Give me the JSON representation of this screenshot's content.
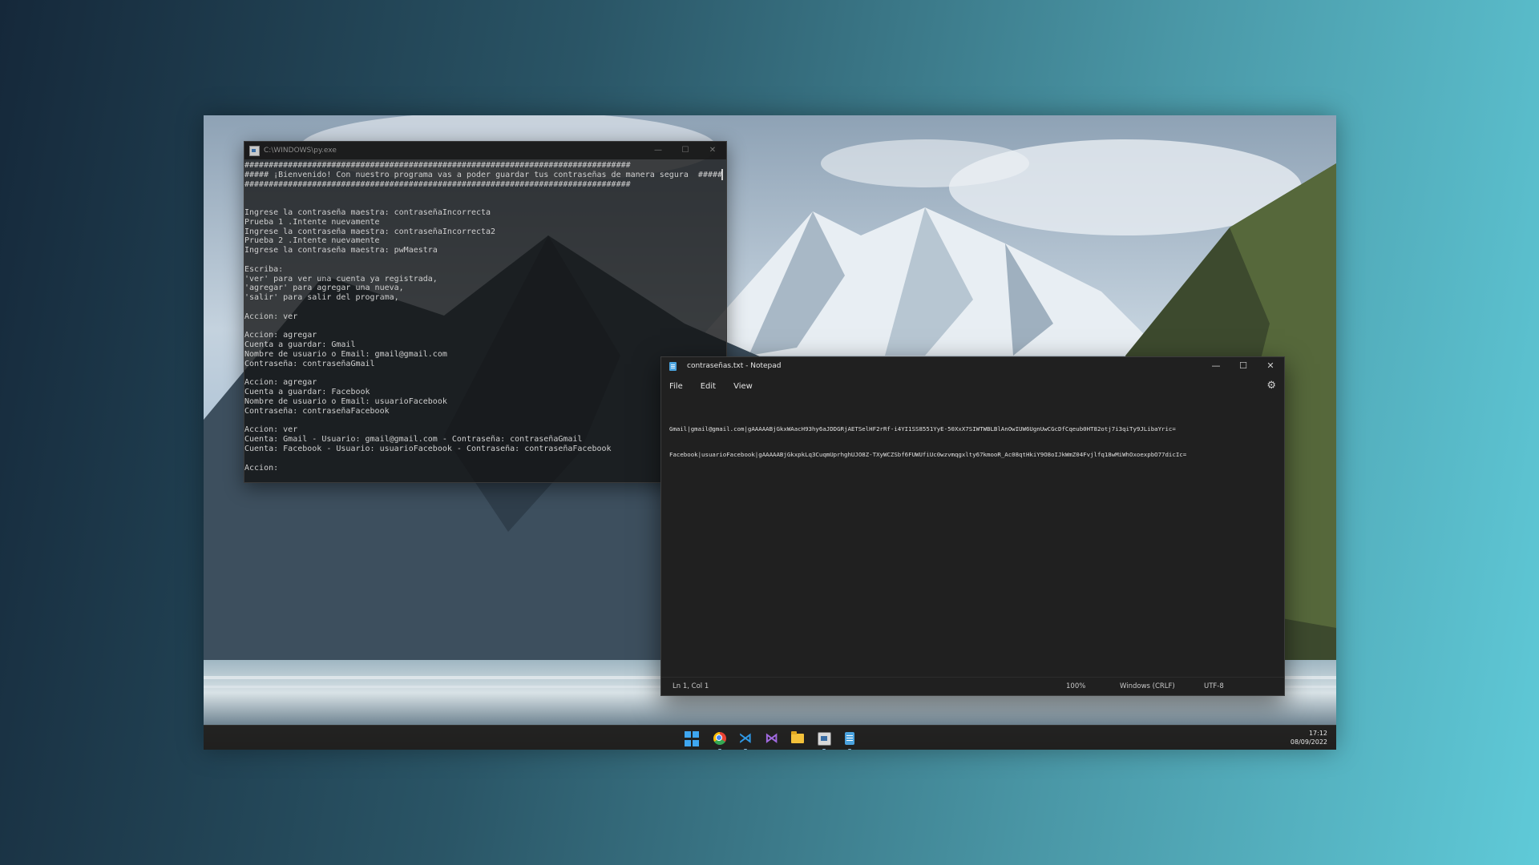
{
  "console": {
    "title": "C:\\WINDOWS\\py.exe",
    "buttons": {
      "minimize": "—",
      "maximize": "☐",
      "close": "✕"
    },
    "lines": [
      "################################################################################",
      "##### ¡Bienvenido! Con nuestro programa vas a poder guardar tus contraseñas de manera segura  #####",
      "################################################################################",
      "",
      "",
      "Ingrese la contraseña maestra: contraseñaIncorrecta",
      "Prueba 1 .Intente nuevamente",
      "Ingrese la contraseña maestra: contraseñaIncorrecta2",
      "Prueba 2 .Intente nuevamente",
      "Ingrese la contraseña maestra: pwMaestra",
      "",
      "Escriba:",
      "'ver' para ver una cuenta ya registrada,",
      "'agregar' para agregar una nueva,",
      "'salir' para salir del programa,",
      "",
      "Accion: ver",
      "",
      "Accion: agregar",
      "Cuenta a guardar: Gmail",
      "Nombre de usuario o Email: gmail@gmail.com",
      "Contraseña: contraseñaGmail",
      "",
      "Accion: agregar",
      "Cuenta a guardar: Facebook",
      "Nombre de usuario o Email: usuarioFacebook",
      "Contraseña: contraseñaFacebook",
      "",
      "Accion: ver",
      "Cuenta: Gmail - Usuario: gmail@gmail.com - Contraseña: contraseñaGmail",
      "Cuenta: Facebook - Usuario: usuarioFacebook - Contraseña: contraseñaFacebook",
      "",
      "Accion:"
    ]
  },
  "notepad": {
    "title": "contraseñas.txt - Notepad",
    "buttons": {
      "minimize": "—",
      "maximize": "☐",
      "close": "✕"
    },
    "menu": [
      "File",
      "Edit",
      "View"
    ],
    "settings_icon": "gear-icon",
    "content_lines": [
      "Gmail|gmail@gmail.com|gAAAAABjGkxWAacH93hy6aJDDGRjAETSelHF2rRf-i4YI1SS8551YyE-50XxX7SIWTWBLBlAnOwIUW6UgnUwCGcDfCqeub0HT82otj7i3qiTy9JLibaYric=",
      "Facebook|usuarioFacebook|gAAAAABjGkxpkLq3CuqmUprhghUJO8Z-TXyWCZSbf6FUWUfiUc0wzvmqgxlty67kmooR_Ac08qtHkiY9O8oIJkWmZ04Fvjlfq18wMiWhOxoexpbO77dicIc="
    ],
    "status": {
      "position": "Ln 1, Col 1",
      "zoom": "100%",
      "line_ending": "Windows (CRLF)",
      "encoding": "UTF-8"
    }
  },
  "taskbar": {
    "icons": [
      "windows-start-icon",
      "chrome-icon",
      "vscode-icon",
      "visual-studio-icon",
      "file-explorer-icon",
      "python-launcher-icon",
      "notepad-icon"
    ],
    "time": "17:12",
    "date": "08/09/2022"
  },
  "colors": {
    "notepad_bg": "#202020",
    "console_text": "#cfcfcf",
    "accent_blue": "#3ea6f0"
  }
}
